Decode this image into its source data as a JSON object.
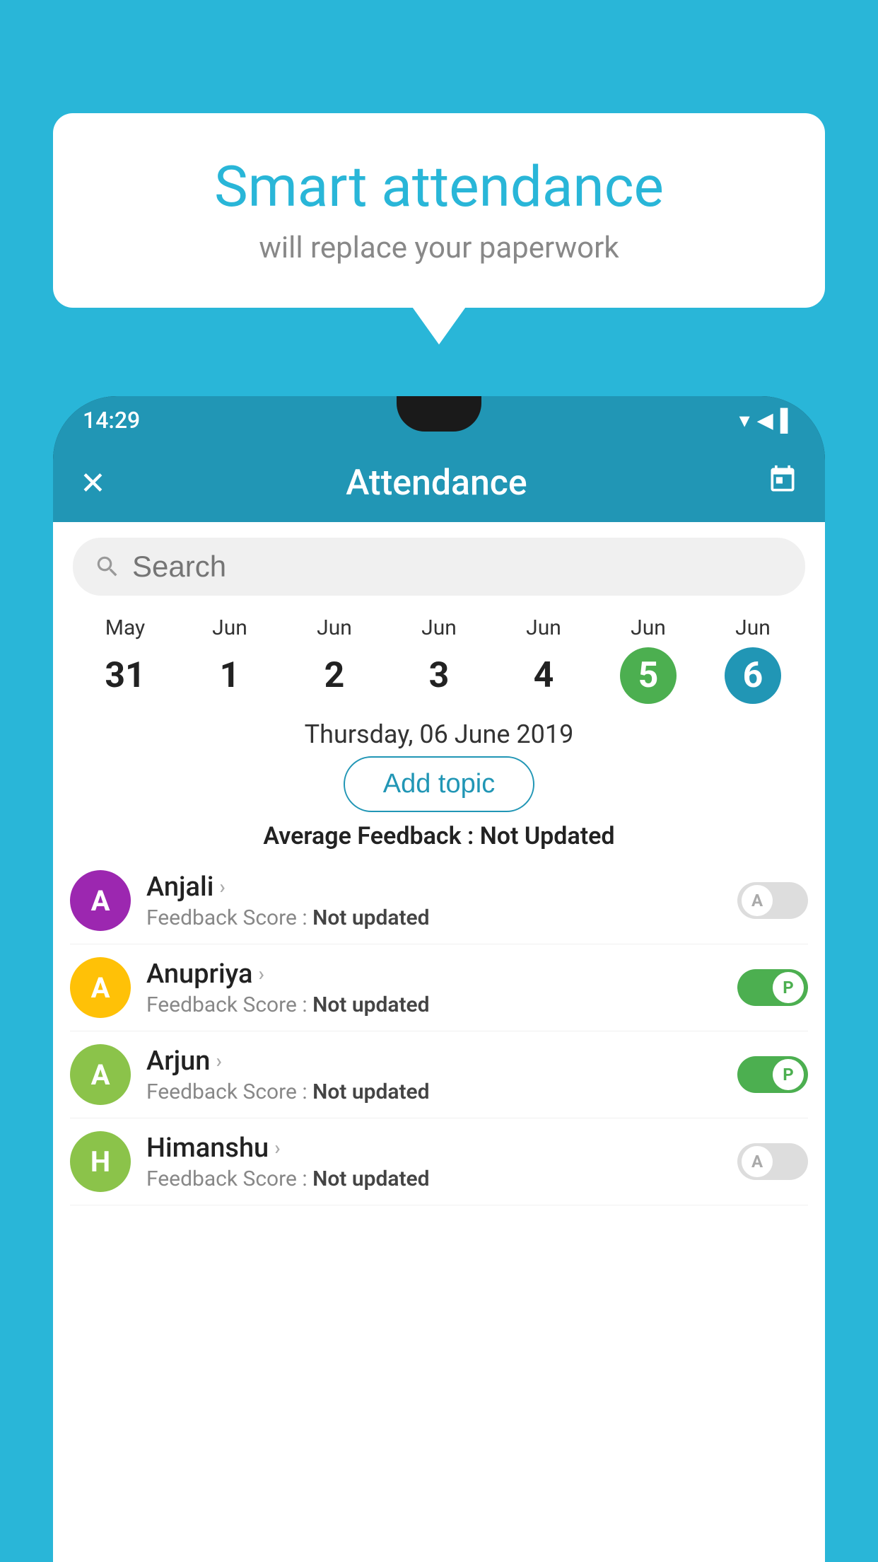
{
  "background_color": "#29b6d8",
  "bubble": {
    "title": "Smart attendance",
    "subtitle": "will replace your paperwork"
  },
  "status_bar": {
    "time": "14:29",
    "icons": [
      "▾",
      "◀",
      "▌"
    ]
  },
  "app_bar": {
    "close_label": "✕",
    "title": "Attendance",
    "calendar_icon": "📅"
  },
  "search": {
    "placeholder": "Search"
  },
  "calendar": {
    "days": [
      {
        "month": "May",
        "date": "31",
        "state": "normal"
      },
      {
        "month": "Jun",
        "date": "1",
        "state": "normal"
      },
      {
        "month": "Jun",
        "date": "2",
        "state": "normal"
      },
      {
        "month": "Jun",
        "date": "3",
        "state": "normal"
      },
      {
        "month": "Jun",
        "date": "4",
        "state": "normal"
      },
      {
        "month": "Jun",
        "date": "5",
        "state": "today"
      },
      {
        "month": "Jun",
        "date": "6",
        "state": "selected"
      }
    ]
  },
  "selected_date": "Thursday, 06 June 2019",
  "add_topic_label": "Add topic",
  "average_feedback": {
    "label": "Average Feedback :",
    "value": "Not Updated"
  },
  "students": [
    {
      "name": "Anjali",
      "initial": "A",
      "feedback": "Not updated",
      "status": "absent",
      "avatar_color": "#9c27b0"
    },
    {
      "name": "Anupriya",
      "initial": "A",
      "feedback": "Not updated",
      "status": "present",
      "avatar_color": "#ffc107"
    },
    {
      "name": "Arjun",
      "initial": "A",
      "feedback": "Not updated",
      "status": "present",
      "avatar_color": "#8bc34a"
    },
    {
      "name": "Himanshu",
      "initial": "H",
      "feedback": "Not updated",
      "status": "absent",
      "avatar_color": "#8bc34a"
    }
  ],
  "toggle_labels": {
    "absent": "A",
    "present": "P"
  }
}
